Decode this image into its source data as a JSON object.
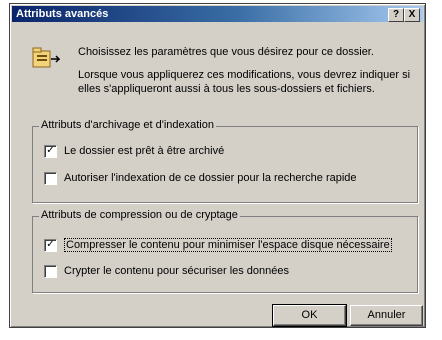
{
  "window": {
    "title": "Attributs avancés",
    "help_label": "?",
    "close_label": "X"
  },
  "intro": {
    "icon": "folder-attributes-icon",
    "line1": "Choisissez les paramètres que vous désirez pour ce dossier.",
    "line2": "Lorsque vous appliquerez ces modifications, vous devrez indiquer si elles s'appliqueront aussi à tous les sous-dossiers et fichiers."
  },
  "archive_group": {
    "title": "Attributs d'archivage et d'indexation",
    "options": [
      {
        "label": "Le dossier est prêt à être archivé",
        "checked": true
      },
      {
        "label": "Autoriser l'indexation de ce dossier pour la recherche rapide",
        "checked": false
      }
    ]
  },
  "compress_group": {
    "title": "Attributs de compression ou de cryptage",
    "options": [
      {
        "label": "Compresser le contenu pour minimiser l'espace disque nécessaire",
        "checked": true
      },
      {
        "label": "Crypter le contenu pour sécuriser les données",
        "checked": false
      }
    ]
  },
  "buttons": {
    "ok": "OK",
    "cancel": "Annuler"
  },
  "check_mark": "✓"
}
